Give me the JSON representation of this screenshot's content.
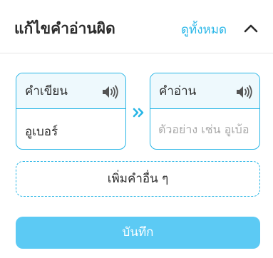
{
  "header": {
    "title": "แก้ไขคำอ่านผิด",
    "view_all_label": "ดูทั้งหมด",
    "collapse_icon": "chevron-up-icon"
  },
  "word_entry": {
    "written_label": "คำเขียน",
    "written_value": "อูเบอร์",
    "reading_label": "คำอ่าน",
    "reading_placeholder": "ตัวอย่าง เช่น อูเบ้อ",
    "reading_value": "",
    "speaker_icon": "speaker-icon",
    "arrow_icon": "double-chevron-right-icon"
  },
  "actions": {
    "add_more_label": "เพิ่มคำอื่น ๆ",
    "save_label": "บันทึก"
  },
  "colors": {
    "accent": "#29b6e6",
    "link": "#2ab7e8",
    "box_header_bg": "#eef9fd",
    "save_button_bg": "#5ccaf4",
    "text": "#2b2b2b",
    "placeholder": "#a9a9a9"
  }
}
